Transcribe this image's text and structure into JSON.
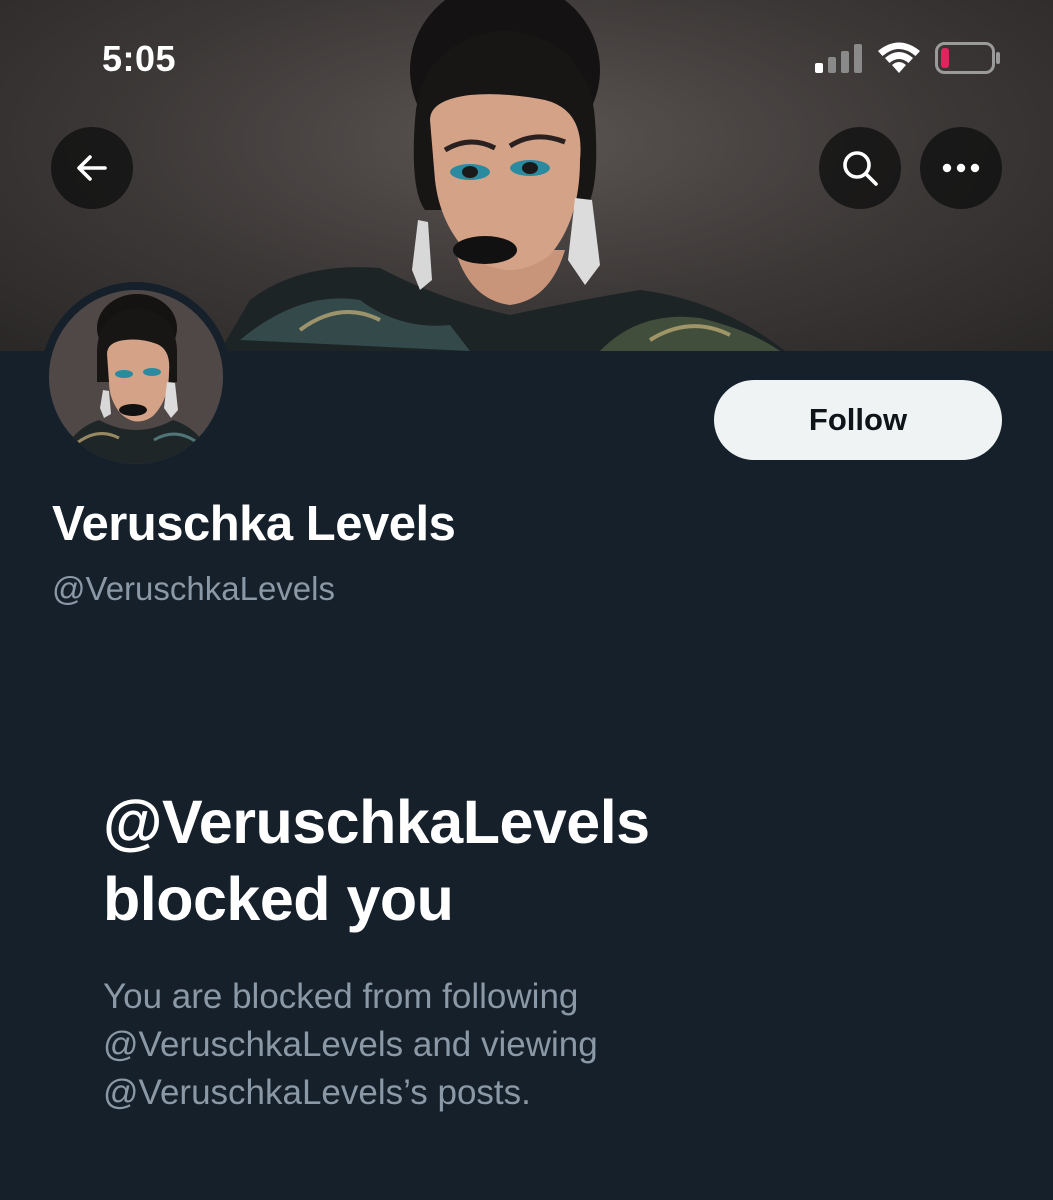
{
  "status_bar": {
    "time": "5:05",
    "icons": [
      "cellular-signal-icon",
      "wifi-icon",
      "battery-low-icon"
    ]
  },
  "header": {
    "back_icon": "arrow-left-icon",
    "search_icon": "search-icon",
    "more_icon": "ellipsis-icon"
  },
  "profile": {
    "display_name": "Veruschka Levels",
    "handle": "@VeruschkaLevels",
    "follow_label": "Follow"
  },
  "blocked": {
    "title_line1": "@VeruschkaLevels",
    "title_line2": "blocked you",
    "desc_line1": "You are blocked from following",
    "desc_line2": "@VeruschkaLevels and viewing",
    "desc_line3": "@VeruschkaLevels’s posts."
  },
  "colors": {
    "background": "#15202b",
    "text_primary": "#ffffff",
    "text_secondary": "#8b98a5",
    "follow_button_bg": "#eff3f4",
    "battery_low": "#e0245e"
  }
}
